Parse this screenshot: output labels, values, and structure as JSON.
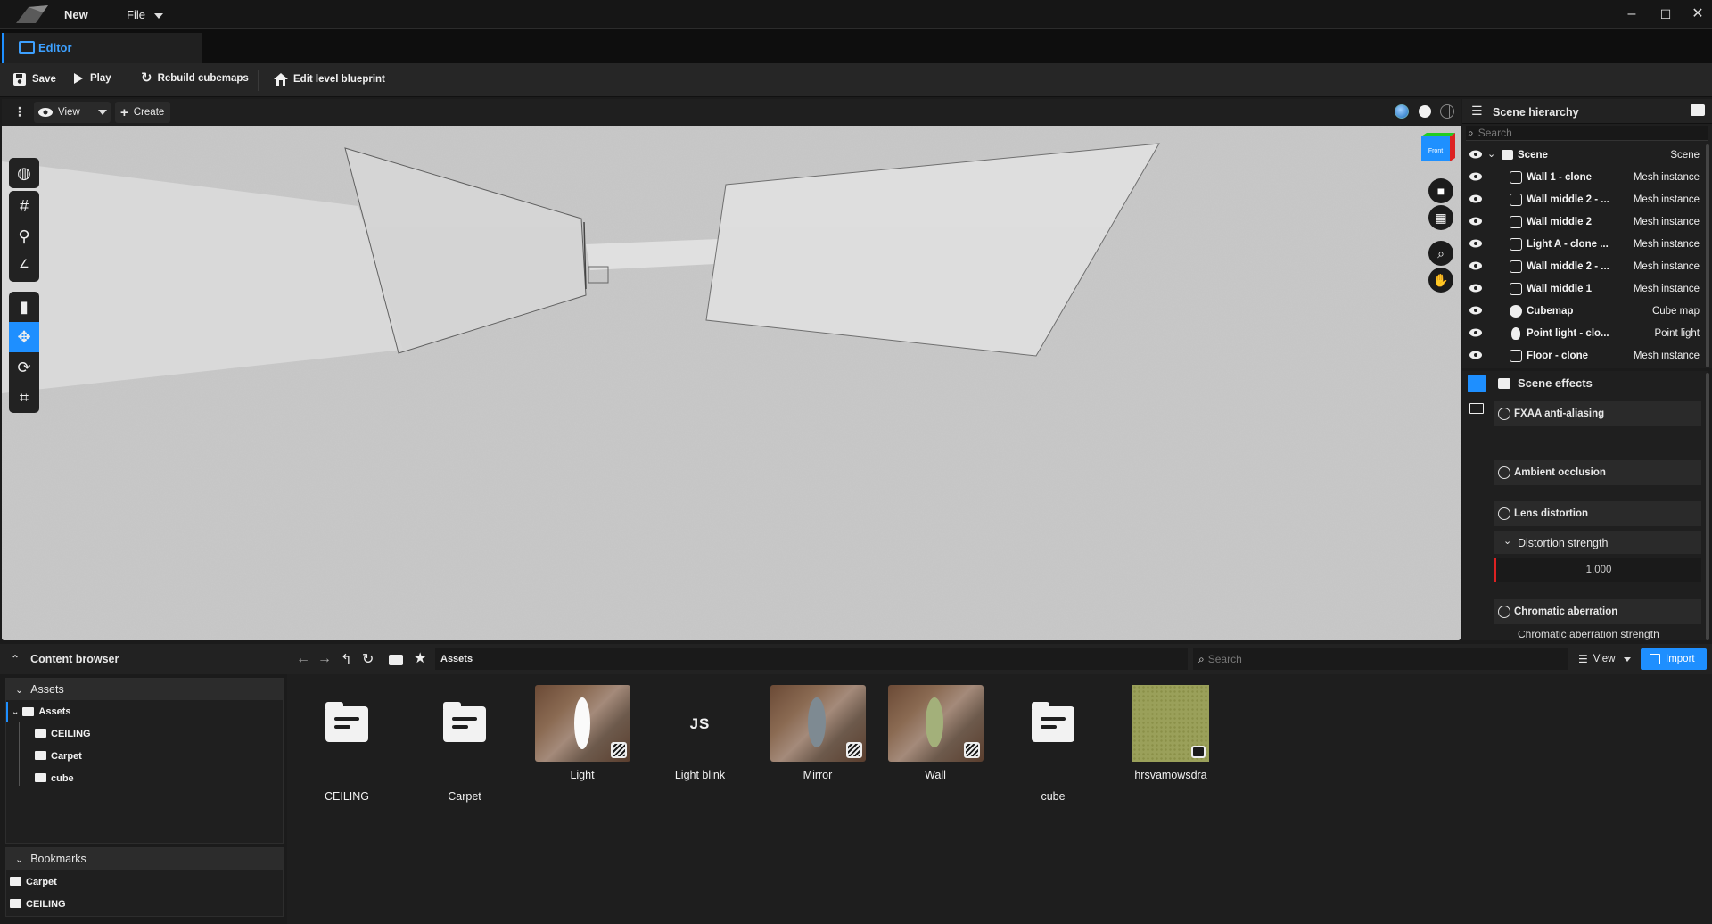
{
  "titlebar": {
    "new_label": "New",
    "file_label": "File",
    "minimize": "–",
    "maximize": "☐",
    "close": "✕"
  },
  "tab": {
    "label": "Editor"
  },
  "toolbar": {
    "save": "Save",
    "play": "Play",
    "rebuild": "Rebuild cubemaps",
    "edit_blueprint": "Edit level blueprint"
  },
  "viewport_bar": {
    "view": "View",
    "create": "Create"
  },
  "viewcube": {
    "label": "Front"
  },
  "hierarchy": {
    "title": "Scene hierarchy",
    "search_placeholder": "Search",
    "root": {
      "name": "Scene",
      "type": "Scene"
    },
    "items": [
      {
        "name": "Wall 1 - clone",
        "type": "Mesh instance",
        "icon": "mesh-icon"
      },
      {
        "name": "Wall middle 2 - ...",
        "type": "Mesh instance",
        "icon": "mesh-icon"
      },
      {
        "name": "Wall middle 2",
        "type": "Mesh instance",
        "icon": "mesh-icon"
      },
      {
        "name": "Light A - clone ...",
        "type": "Mesh instance",
        "icon": "mesh-icon"
      },
      {
        "name": "Wall middle 2 - ...",
        "type": "Mesh instance",
        "icon": "mesh-icon"
      },
      {
        "name": "Wall middle 1",
        "type": "Mesh instance",
        "icon": "mesh-icon"
      },
      {
        "name": "Cubemap",
        "type": "Cube map",
        "icon": "cubemap-icon"
      },
      {
        "name": "Point light - clo...",
        "type": "Point light",
        "icon": "bulb-icon"
      },
      {
        "name": "Floor - clone",
        "type": "Mesh instance",
        "icon": "mesh-icon"
      }
    ]
  },
  "effects": {
    "title": "Scene effects",
    "fxaa": "FXAA anti-aliasing",
    "ao": "Ambient occlusion",
    "lens": "Lens distortion",
    "distortion_strength": "Distortion strength",
    "distortion_value": "1.000",
    "chromatic": "Chromatic aberration",
    "chromatic_strength": "Chromatic aberration strength"
  },
  "content_browser": {
    "title": "Content browser",
    "assets_section": "Assets",
    "tree_root": "Assets",
    "tree_children": [
      "CEILING",
      "Carpet",
      "cube"
    ],
    "bookmarks_section": "Bookmarks",
    "bookmarks": [
      "Carpet",
      "CEILING"
    ],
    "path": "Assets",
    "search_placeholder": "Search",
    "view": "View",
    "import": "Import",
    "assets": [
      {
        "name": "CEILING",
        "kind": "folder"
      },
      {
        "name": "Carpet",
        "kind": "folder"
      },
      {
        "name": "Light",
        "kind": "material"
      },
      {
        "name": "Light blink",
        "kind": "script",
        "glyph": "JS"
      },
      {
        "name": "Mirror",
        "kind": "material"
      },
      {
        "name": "Wall",
        "kind": "material"
      },
      {
        "name": "cube",
        "kind": "folder"
      },
      {
        "name": "hrsvamowsdra",
        "kind": "texture"
      }
    ]
  },
  "colors": {
    "accent": "#1e8fff",
    "panel": "#1f1f1f",
    "texture_swatch": "#9aa05a"
  }
}
